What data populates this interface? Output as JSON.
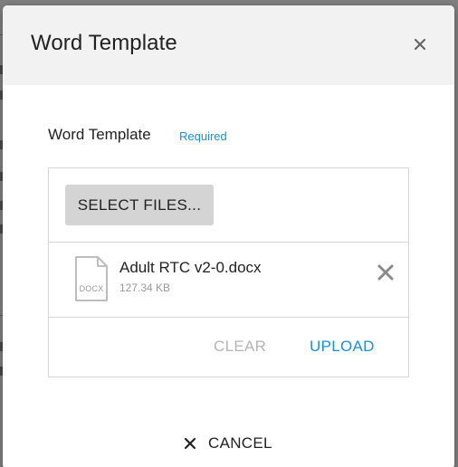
{
  "modal": {
    "title": "Word Template",
    "close_icon": "close-icon"
  },
  "field": {
    "label": "Word Template",
    "required_text": "Required"
  },
  "upload": {
    "select_files_label": "SELECT FILES...",
    "file": {
      "name": "Adult RTC v2-0.docx",
      "size": "127.34 KB",
      "type_label": "DOCX",
      "icon": "document-icon",
      "remove_icon": "remove-icon"
    },
    "clear_label": "CLEAR",
    "upload_label": "UPLOAD"
  },
  "footer": {
    "cancel_label": "CANCEL",
    "cancel_icon": "close-icon"
  },
  "colors": {
    "accent": "#1a8fd8",
    "disabled": "#b5b5b5",
    "header_bg": "#f2f2f2",
    "button_bg": "#d4d4d4"
  }
}
